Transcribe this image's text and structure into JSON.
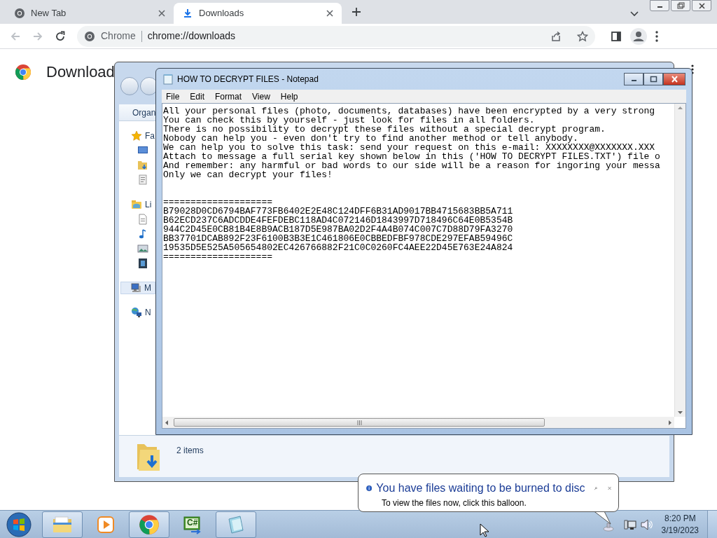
{
  "browser": {
    "tabs": [
      {
        "label": "New Tab",
        "selected": false
      },
      {
        "label": "Downloads",
        "selected": true
      }
    ],
    "address_bar": {
      "site_chip": "Chrome",
      "url": "chrome://downloads"
    },
    "page": {
      "title": "Download"
    }
  },
  "explorer": {
    "toolbar_label": "Organ",
    "nav_items": [
      {
        "label": "Fa",
        "kind": "favorites",
        "selected": false
      },
      {
        "label": "Li",
        "kind": "libraries",
        "selected": false
      },
      {
        "label": "M",
        "kind": "computer",
        "selected": true
      },
      {
        "label": "N",
        "kind": "network",
        "selected": false
      }
    ],
    "status": "2 items"
  },
  "notepad": {
    "title": "HOW TO DECRYPT FILES - Notepad",
    "menu": [
      "File",
      "Edit",
      "Format",
      "View",
      "Help"
    ],
    "message": [
      "All your personal files (photo, documents, databases) have been encrypted by a very strong",
      "You can check this by yourself - just look for files in all folders.",
      "There is no possibility to decrypt these files without a special decrypt program.",
      "Nobody can help you - even don't try to find another method or tell anybody.",
      "We can help you to solve this task: send your request on this e-mail: XXXXXXXX@XXXXXXX.XXX",
      "Attach to message a full serial key shown below in this ('HOW TO DECRYPT FILES.TXT') file o",
      "And remember: any harmful or bad words to our side will be a reason for ingoring your messa",
      "Only we can decrypt your files!"
    ],
    "separator_top": "====================",
    "keys": [
      "B79028D0CD6794BAF773FB6402E2E48C124DFF6B31AD9017BB4715683BB5A711",
      "B62ECD237C6ADCDDE4FEFDEBC118AD4C072146D1843997D718496C64E0B5354B",
      "944C2D45E0CB81B4E8B9ACB187D5E987BA02D2F4A4B074C007C7D88D79FA3270",
      "BB37701DCAB892F23F6100B3B3E1C461806E0CBBEDFBF978CDE297EFAB59496C",
      "19535D5E525A505654802EC426766882F21C0C0260FC4AEE22D45E763E24A824"
    ],
    "separator_bottom": "===================="
  },
  "balloon": {
    "title": "You have files waiting to be burned to disc",
    "message": "To view the files now, click this balloon."
  },
  "taskbar": {
    "buttons": [
      {
        "kind": "explorer",
        "running": true
      },
      {
        "kind": "media",
        "running": false
      },
      {
        "kind": "chrome",
        "running": true
      },
      {
        "kind": "csharp",
        "running": false,
        "label": "C#"
      },
      {
        "kind": "notepad",
        "running": true
      }
    ],
    "clock": {
      "time": "8:20 PM",
      "date": "3/19/2023"
    }
  }
}
